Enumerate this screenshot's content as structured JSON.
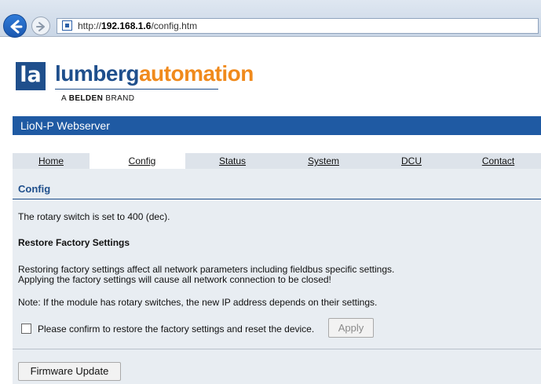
{
  "browser": {
    "url_prefix": "http://",
    "url_host": "192.168.1.6",
    "url_path": "/config.htm"
  },
  "logo": {
    "word_part1": "lumberg",
    "word_part2": "automation",
    "mark_letter": "la",
    "tagline_prefix": "A ",
    "tagline_bold": "BELDEN",
    "tagline_suffix": " BRAND"
  },
  "titlebar": {
    "title": "LioN-P Webserver"
  },
  "tabs": [
    {
      "label": "Home"
    },
    {
      "label": "Config",
      "active": true
    },
    {
      "label": "Status"
    },
    {
      "label": "System"
    },
    {
      "label": "DCU"
    },
    {
      "label": "Contact"
    }
  ],
  "content": {
    "heading": "Config",
    "rotary": "The rotary switch is set to 400 (dec).",
    "restore_heading": "Restore Factory Settings",
    "restore_line1": "Restoring factory settings affect all network parameters including fieldbus specific settings.",
    "restore_line2": "Applying the factory settings will cause all network connection to be closed!",
    "note": "Note: If the module has rotary switches, the new IP address depends on their settings.",
    "confirm_label": "Please confirm to restore the factory settings and reset the device.",
    "confirm_checked": false,
    "apply_label": "Apply",
    "firmware_label": "Firmware Update"
  },
  "colors": {
    "brand_blue": "#1f4f8c",
    "brand_orange": "#f08a1c",
    "titlebar": "#1f5aa3",
    "panel": "#e8edf2"
  }
}
